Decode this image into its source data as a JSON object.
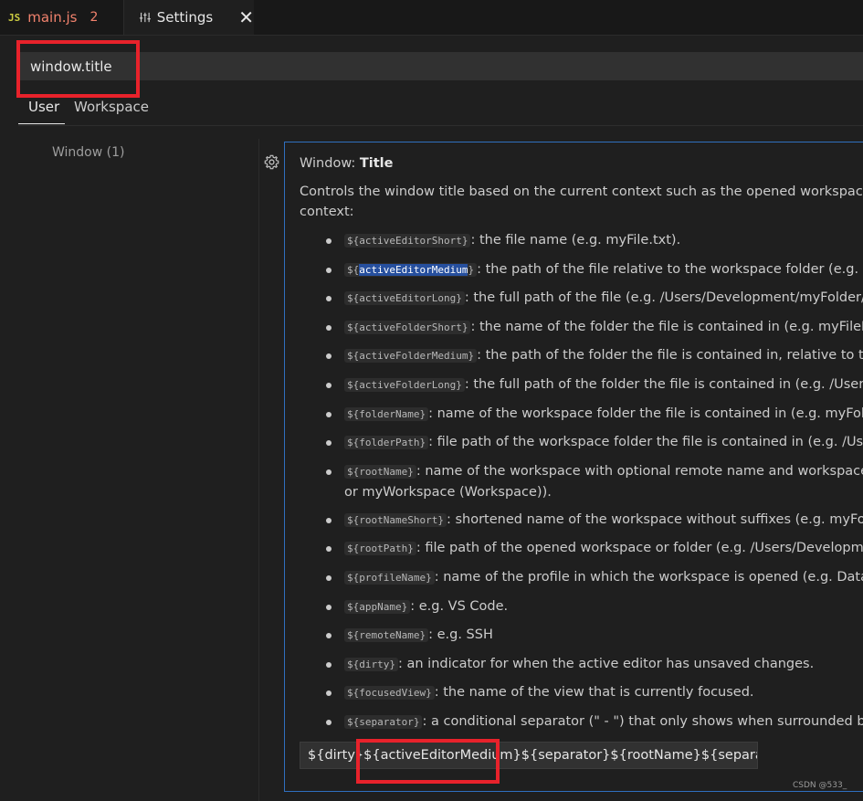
{
  "tabs": {
    "mainjs": {
      "icon_text": "JS",
      "label": "main.js",
      "count": "2"
    },
    "settings": {
      "label": "Settings",
      "close": "✕"
    }
  },
  "search": {
    "value": "window.title"
  },
  "scope": {
    "user": "User",
    "workspace": "Workspace"
  },
  "toc": {
    "window": "Window (1)"
  },
  "setting": {
    "category": "Window: ",
    "name": "Title",
    "desc_line1": "Controls the window title based on the current context such as the opened workspace or a",
    "desc_line2": "context:",
    "items": [
      {
        "var": "${activeEditorShort}",
        "text": ": the file name (e.g. myFile.txt)."
      },
      {
        "var_pre": "${",
        "var_sel": "activeEditorMedium",
        "var_post": "}",
        "text": ": the path of the file relative to the workspace folder (e.g. my"
      },
      {
        "var": "${activeEditorLong}",
        "text": ": the full path of the file (e.g. /Users/Development/myFolder/m"
      },
      {
        "var": "${activeFolderShort}",
        "text": ": the name of the folder the file is contained in (e.g. myFileFo"
      },
      {
        "var": "${activeFolderMedium}",
        "text": ": the path of the folder the file is contained in, relative to the"
      },
      {
        "var": "${activeFolderLong}",
        "text": ": the full path of the folder the file is contained in (e.g. /Users/"
      },
      {
        "var": "${folderName}",
        "text": ": name of the workspace folder the file is contained in (e.g. myFolder"
      },
      {
        "var": "${folderPath}",
        "text": ": file path of the workspace folder the file is contained in (e.g. /Users"
      },
      {
        "var": "${rootName}",
        "text": ": name of the workspace with optional remote name and workspace in",
        "text2": "or myWorkspace (Workspace))."
      },
      {
        "var": "${rootNameShort}",
        "text": ": shortened name of the workspace without suffixes (e.g. myFolde"
      },
      {
        "var": "${rootPath}",
        "text": ": file path of the opened workspace or folder (e.g. /Users/Development"
      },
      {
        "var": "${profileName}",
        "text": ": name of the profile in which the workspace is opened (e.g. Data Sc"
      },
      {
        "var": "${appName}",
        "text": ": e.g. VS Code."
      },
      {
        "var": "${remoteName}",
        "text": ": e.g. SSH"
      },
      {
        "var": "${dirty}",
        "text": ": an indicator for when the active editor has unsaved changes."
      },
      {
        "var": "${focusedView}",
        "text": ": the name of the view that is currently focused."
      },
      {
        "var": "${separator}",
        "text": ": a conditional separator (\" - \") that only shows when surrounded by v"
      }
    ],
    "value": "${dirty}${activeEditorMedium}${separator}${rootName}${separator}${..."
  },
  "watermark": "CSDN @533_",
  "colors": {
    "highlight_box": "#e8222b",
    "focus_border": "#2f6fbf",
    "selection": "#264f9e"
  }
}
